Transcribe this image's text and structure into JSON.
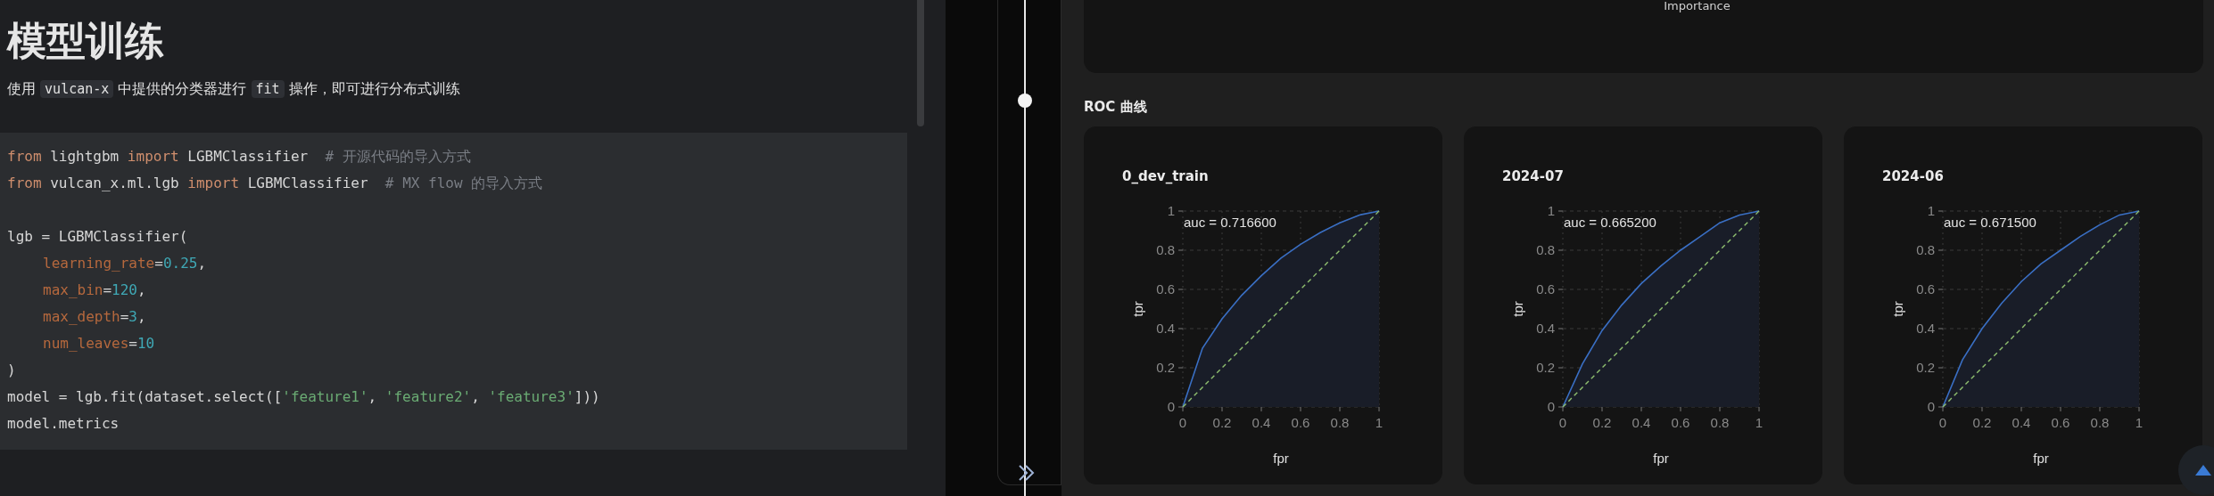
{
  "notebook": {
    "title": "模型训练",
    "description": [
      {
        "text": "使用 ",
        "code": false
      },
      {
        "text": "vulcan-x",
        "code": true
      },
      {
        "text": " 中提供的分类器进行 ",
        "code": false
      },
      {
        "text": "fit",
        "code": true
      },
      {
        "text": " 操作，即可进行分布式训练",
        "code": false
      }
    ],
    "code_lines": [
      {
        "gap_before": false,
        "indent": false,
        "tokens": [
          {
            "kind": "keyword",
            "text": "from"
          },
          {
            "kind": "plain",
            "text": " lightgbm "
          },
          {
            "kind": "keyword",
            "text": "import"
          },
          {
            "kind": "plain",
            "text": " LGBMClassifier  "
          },
          {
            "kind": "comment",
            "text": "# 开源代码的导入方式"
          }
        ]
      },
      {
        "gap_before": false,
        "indent": false,
        "tokens": [
          {
            "kind": "keyword",
            "text": "from"
          },
          {
            "kind": "plain",
            "text": " vulcan_x.ml.lgb "
          },
          {
            "kind": "keyword",
            "text": "import"
          },
          {
            "kind": "plain",
            "text": " LGBMClassifier  "
          },
          {
            "kind": "comment",
            "text": "# MX flow 的导入方式"
          }
        ]
      },
      {
        "gap_before": true,
        "indent": false,
        "tokens": [
          {
            "kind": "plain",
            "text": "lgb = LGBMClassifier("
          }
        ]
      },
      {
        "gap_before": false,
        "indent": true,
        "tokens": [
          {
            "kind": "param",
            "text": "learning_rate"
          },
          {
            "kind": "plain",
            "text": "="
          },
          {
            "kind": "number",
            "text": "0.25"
          },
          {
            "kind": "plain",
            "text": ","
          }
        ]
      },
      {
        "gap_before": false,
        "indent": true,
        "tokens": [
          {
            "kind": "param",
            "text": "max_bin"
          },
          {
            "kind": "plain",
            "text": "="
          },
          {
            "kind": "number",
            "text": "120"
          },
          {
            "kind": "plain",
            "text": ","
          }
        ]
      },
      {
        "gap_before": false,
        "indent": true,
        "tokens": [
          {
            "kind": "param",
            "text": "max_depth"
          },
          {
            "kind": "plain",
            "text": "="
          },
          {
            "kind": "number",
            "text": "3"
          },
          {
            "kind": "plain",
            "text": ","
          }
        ]
      },
      {
        "gap_before": false,
        "indent": true,
        "tokens": [
          {
            "kind": "param",
            "text": "num_leaves"
          },
          {
            "kind": "plain",
            "text": "="
          },
          {
            "kind": "number",
            "text": "10"
          }
        ]
      },
      {
        "gap_before": false,
        "indent": false,
        "tokens": [
          {
            "kind": "plain",
            "text": ")"
          }
        ]
      },
      {
        "gap_before": false,
        "indent": false,
        "tokens": [
          {
            "kind": "plain",
            "text": "model = lgb.fit(dataset.select(["
          },
          {
            "kind": "string",
            "text": "'feature1'"
          },
          {
            "kind": "plain",
            "text": ", "
          },
          {
            "kind": "string",
            "text": "'feature2'"
          },
          {
            "kind": "plain",
            "text": ", "
          },
          {
            "kind": "string",
            "text": "'feature3'"
          },
          {
            "kind": "plain",
            "text": "]))"
          }
        ]
      },
      {
        "gap_before": false,
        "indent": false,
        "tokens": [
          {
            "kind": "plain",
            "text": "model.metrics"
          }
        ]
      }
    ]
  },
  "importance_panel": {
    "axis_label": "Importance"
  },
  "roc_section": {
    "title": "ROC 曲线",
    "charts": [
      {
        "chart_data": {
          "type": "line",
          "title": "0_dev_train",
          "xlabel": "fpr",
          "ylabel": "tpr",
          "x": [
            0,
            0.1,
            0.2,
            0.3,
            0.4,
            0.5,
            0.6,
            0.7,
            0.8,
            0.9,
            1
          ],
          "xlim": [
            0,
            1
          ],
          "ylim": [
            0,
            1
          ],
          "xticks": [
            0,
            0.2,
            0.4,
            0.6,
            0.8,
            1
          ],
          "yticks": [
            0,
            0.2,
            0.4,
            0.6,
            0.8,
            1
          ],
          "annotations": [
            "auc = 0.716600"
          ],
          "grid": true,
          "series": [
            {
              "color": "#3a6fc4",
              "line_style": "solid",
              "values": [
                0,
                0.3,
                0.45,
                0.57,
                0.67,
                0.76,
                0.83,
                0.89,
                0.94,
                0.98,
                1
              ]
            },
            {
              "color": "#8fbf6f",
              "line_style": "dashed",
              "values": [
                0,
                0.1,
                0.2,
                0.3,
                0.4,
                0.5,
                0.6,
                0.7,
                0.8,
                0.9,
                1
              ]
            }
          ]
        }
      },
      {
        "chart_data": {
          "type": "line",
          "title": "2024-07",
          "xlabel": "fpr",
          "ylabel": "tpr",
          "x": [
            0,
            0.1,
            0.2,
            0.3,
            0.4,
            0.5,
            0.6,
            0.7,
            0.8,
            0.9,
            1
          ],
          "xlim": [
            0,
            1
          ],
          "ylim": [
            0,
            1
          ],
          "xticks": [
            0,
            0.2,
            0.4,
            0.6,
            0.8,
            1
          ],
          "yticks": [
            0,
            0.2,
            0.4,
            0.6,
            0.8,
            1
          ],
          "annotations": [
            "auc = 0.665200"
          ],
          "grid": true,
          "series": [
            {
              "color": "#3a6fc4",
              "line_style": "solid",
              "values": [
                0,
                0.22,
                0.39,
                0.52,
                0.63,
                0.72,
                0.8,
                0.87,
                0.94,
                0.98,
                1
              ]
            },
            {
              "color": "#8fbf6f",
              "line_style": "dashed",
              "values": [
                0,
                0.1,
                0.2,
                0.3,
                0.4,
                0.5,
                0.6,
                0.7,
                0.8,
                0.9,
                1
              ]
            }
          ]
        }
      },
      {
        "chart_data": {
          "type": "line",
          "title": "2024-06",
          "xlabel": "fpr",
          "ylabel": "tpr",
          "x": [
            0,
            0.1,
            0.2,
            0.3,
            0.4,
            0.5,
            0.6,
            0.7,
            0.8,
            0.9,
            1
          ],
          "xlim": [
            0,
            1
          ],
          "ylim": [
            0,
            1
          ],
          "xticks": [
            0,
            0.2,
            0.4,
            0.6,
            0.8,
            1
          ],
          "yticks": [
            0,
            0.2,
            0.4,
            0.6,
            0.8,
            1
          ],
          "annotations": [
            "auc = 0.671500"
          ],
          "grid": true,
          "series": [
            {
              "color": "#3a6fc4",
              "line_style": "solid",
              "values": [
                0,
                0.24,
                0.4,
                0.53,
                0.64,
                0.73,
                0.8,
                0.87,
                0.93,
                0.98,
                1
              ]
            },
            {
              "color": "#8fbf6f",
              "line_style": "dashed",
              "values": [
                0,
                0.1,
                0.2,
                0.3,
                0.4,
                0.5,
                0.6,
                0.7,
                0.8,
                0.9,
                1
              ]
            }
          ]
        }
      }
    ]
  }
}
